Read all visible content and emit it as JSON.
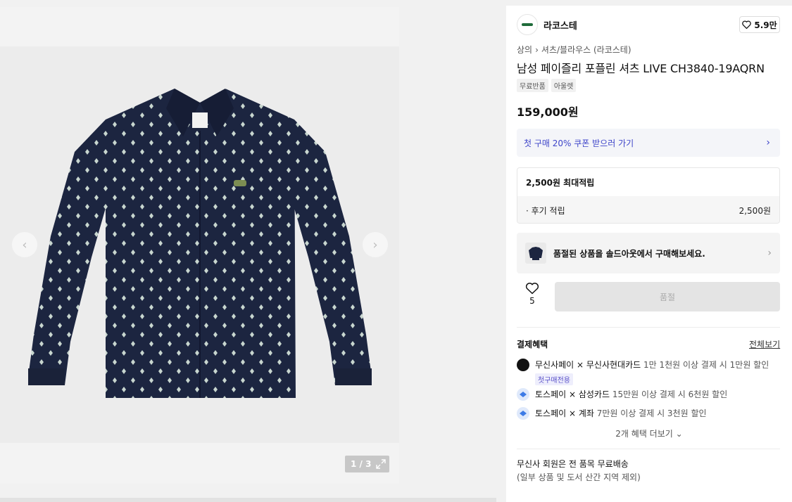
{
  "gallery": {
    "pager": "1 / 3",
    "icons": {
      "prev": "chevron-left-icon",
      "next": "chevron-right-icon",
      "expand": "expand-icon"
    }
  },
  "brand": {
    "name": "라코스테",
    "logo_icon": "lacoste-logo-icon"
  },
  "likes": {
    "count": "5.9만",
    "icon": "heart-icon"
  },
  "breadcrumb": [
    "상의",
    "셔츠/블라우스 (라코스테)"
  ],
  "product": {
    "title": "남성 페이즐리 포플린 셔츠 LIVE CH3840-19AQRN",
    "tags": [
      "무료반품",
      "아울렛"
    ],
    "price": "159,000원"
  },
  "coupon": {
    "label": "첫 구매 20% 쿠폰 받으러 가기",
    "accent": "#3d44c9"
  },
  "points": {
    "title": "2,500원 최대적립",
    "rows": [
      {
        "label": "· 후기 적립",
        "value": "2,500원"
      }
    ]
  },
  "soldout": {
    "label": "품절된 상품을 솔드아웃에서 구매해보세요."
  },
  "wish": {
    "count": "5"
  },
  "buy_button": {
    "label": "품절"
  },
  "payment": {
    "title": "결제혜택",
    "view_all": "전체보기",
    "items": [
      {
        "brand": "무신사페이 × 무신사현대카드",
        "desc": " 1만 1천원 이상 결제 시 1만원 할인",
        "badge": "첫구매전용",
        "icon": "musinsa-pay-icon"
      },
      {
        "brand": "토스페이 × 삼성카드",
        "desc": " 15만원 이상 결제 시 6천원 할인",
        "icon": "toss-pay-icon"
      },
      {
        "brand": "토스페이 × 계좌",
        "desc": " 7만원 이상 결제 시 3천원 할인",
        "icon": "toss-pay-icon"
      }
    ],
    "more": "2개 혜택 더보기"
  },
  "shipping": {
    "line1": "무신사 회원은 전 품목 무료배송",
    "line2": "(일부 상품 및 도서 산간 지역 제외)"
  }
}
